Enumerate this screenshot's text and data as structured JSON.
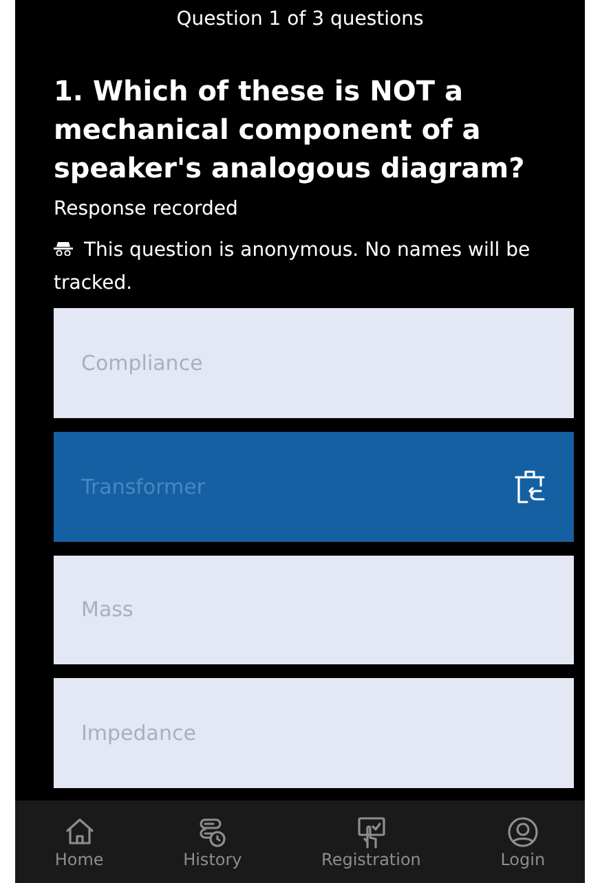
{
  "header": {
    "progress": "Question 1 of 3 questions"
  },
  "question": {
    "title": "1. Which of these is NOT a mechanical component of a speaker's analogous diagram?",
    "status": "Response recorded",
    "notice": "This question is anonymous. No names will be tracked."
  },
  "options": [
    {
      "label": "Compliance",
      "selected": false
    },
    {
      "label": "Transformer",
      "selected": true
    },
    {
      "label": "Mass",
      "selected": false
    },
    {
      "label": "Impedance",
      "selected": false
    }
  ],
  "nav": [
    {
      "label": "Home"
    },
    {
      "label": "History"
    },
    {
      "label": "Registration"
    },
    {
      "label": "Login"
    }
  ]
}
